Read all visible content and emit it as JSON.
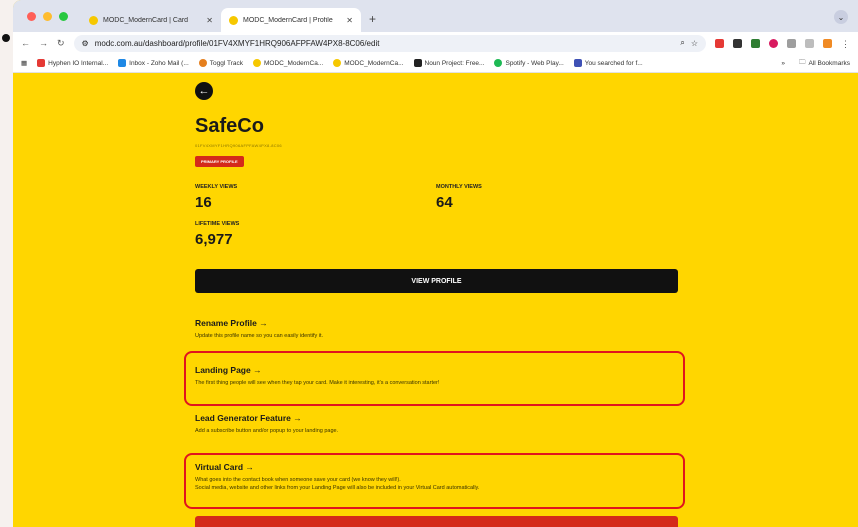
{
  "browser": {
    "tabs": [
      {
        "title": "MODC_ModernCard | Card ",
        "active": false
      },
      {
        "title": "MODC_ModernCard | Profile",
        "active": true
      }
    ],
    "url": "modc.com.au/dashboard/profile/01FV4XMYF1HRQ906AFPFAW4PX8-8C06/edit",
    "bookmarks": [
      {
        "label": "Hyphen IO Internal...",
        "color": "#e53935"
      },
      {
        "label": "Inbox - Zoho Mail (...",
        "color": "#1e88e5"
      },
      {
        "label": "Toggl Track",
        "color": "#e57f1e"
      },
      {
        "label": "MODC_ModernCa...",
        "color": "#f6c800"
      },
      {
        "label": "MODC_ModernCa...",
        "color": "#f6c800"
      },
      {
        "label": "Noun Project: Free...",
        "color": "#222222"
      },
      {
        "label": "Spotify - Web Play...",
        "color": "#1db954"
      },
      {
        "label": "You searched for f...",
        "color": "#3f51b5"
      }
    ],
    "bookmarks_more": "»",
    "all_bookmarks": "All Bookmarks"
  },
  "profile": {
    "name": "SafeCo",
    "id_line": "01FV4XMYF1HRQ906AFPFAW4PX8-8C06",
    "badge": "PRIMARY PROFILE",
    "stats": {
      "weekly_label": "WEEKLY VIEWS",
      "weekly_value": "16",
      "monthly_label": "MONTHLY VIEWS",
      "monthly_value": "64",
      "lifetime_label": "LIFETIME VIEWS",
      "lifetime_value": "6,977"
    },
    "view_button": "VIEW PROFILE"
  },
  "sections": [
    {
      "title": "Rename Profile →",
      "desc": "Update this profile name so you can easily identify it."
    },
    {
      "title": "Landing Page →",
      "desc": "The first thing people will see when they tap your card. Make it interesting, it's a conversation starter!"
    },
    {
      "title": "Lead Generator Feature →",
      "desc": "Add a subscribe button and/or popup to your landing page."
    },
    {
      "title": "Virtual Card →",
      "desc": "What goes into the contact book when someone save your card (we know they will!).",
      "desc2": "Social media, website and other links from your Landing Page will also be included in your Virtual Card automatically."
    }
  ],
  "colors": {
    "page_bg": "#ffd600",
    "badge": "#d42a1a",
    "highlight": "#e0141e",
    "button": "#111111"
  }
}
